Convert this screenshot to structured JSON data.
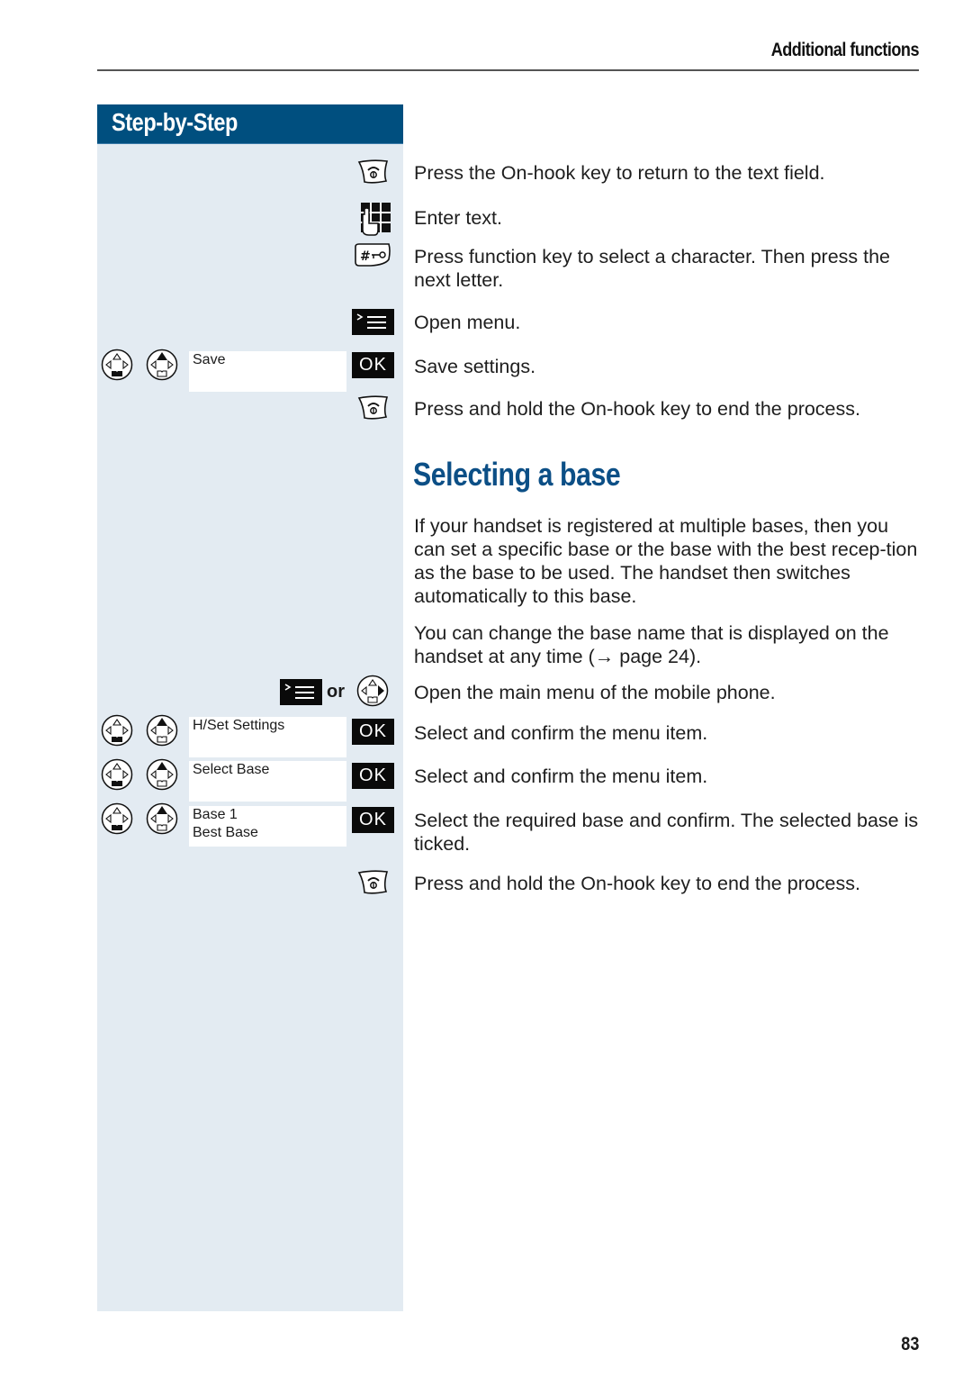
{
  "header": {
    "section_title": "Additional functions"
  },
  "sidebar": {
    "heading": "Step-by-Step",
    "displays": [
      {
        "lines": [
          "Save"
        ]
      },
      {
        "lines": [
          "H/Set Settings"
        ]
      },
      {
        "lines": [
          "Select Base"
        ]
      },
      {
        "lines": [
          "Base 1",
          "Best Base"
        ]
      }
    ],
    "or_label": "or",
    "ok_label": "OK"
  },
  "steps_top": [
    {
      "icon": "on-hook-key-icon",
      "text": "Press the On-hook key to return to the text field."
    },
    {
      "icon": "keypad-icon",
      "text": "Enter text."
    },
    {
      "icon": "hash-key-icon",
      "text": "Press function key to select a character. Then press the next letter."
    },
    {
      "icon": "menu-key-icon",
      "text": "Open menu."
    },
    {
      "icon": "ok-key-icon",
      "text": "Save settings."
    },
    {
      "icon": "on-hook-key-icon",
      "text": "Press and hold the On-hook key to end the process."
    }
  ],
  "section": {
    "title": "Selecting a base",
    "paragraphs": [
      "If your handset is registered at multiple bases, then you can set a specific base or the base with the best recep-tion as the base to be used. The handset then switches automatically to this base.",
      "You can change the base name that is displayed on the handset at any time (→ page 24)."
    ]
  },
  "steps_bottom": [
    {
      "text": "Open the main menu of the mobile phone."
    },
    {
      "text": "Select and confirm the menu item."
    },
    {
      "text": "Select and confirm the menu item."
    },
    {
      "text": "Select the required base and confirm. The selected base is ticked."
    },
    {
      "text": "Press and hold the On-hook key to end the process."
    }
  ],
  "footer": {
    "page_number": "83"
  },
  "colors": {
    "accent": "#004f7f",
    "title": "#0c4f86",
    "sidebar_bg": "#e3ebf2"
  }
}
